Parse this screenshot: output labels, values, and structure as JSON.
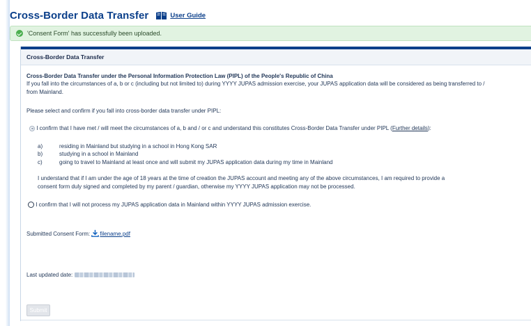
{
  "header": {
    "title": "Cross-Border Data Transfer",
    "user_guide_label": "User Guide",
    "user_guide_icon": "book-icon"
  },
  "alert": {
    "icon": "check-circle-icon",
    "message": "'Consent Form' has successfully been uploaded.",
    "color": "#4caf50"
  },
  "panel": {
    "heading": "Cross-Border Data Transfer",
    "accent_color": "#0b3f8a",
    "intro_title": "Cross-Border Data Transfer under the Personal Information Protection Law (PIPL) of the People's Republic of China",
    "intro_line1": "If you fall into the circumstances of a, b or c (including but not limited to) during YYYY JUPAS admission exercise, your JUPAS application data will be considered as being transferred to /",
    "intro_line2": "from Mainland.",
    "prompt": "Please select and confirm if you fall into cross-border data transfer under PIPL:",
    "option1_text": "I confirm that I have met / will meet the circumstances of a, b and / or c and understand this constitutes Cross-Border Data Transfer under PIPL (",
    "option1_link": "Further details",
    "option1_suffix": "):",
    "circumstances": [
      {
        "letter": "a)",
        "text": "residing in Mainland but studying in a school in Hong Kong SAR"
      },
      {
        "letter": "b)",
        "text": "studying in a school in Mainland"
      },
      {
        "letter": "c)",
        "text": "going to travel to Mainland at least once and will submit my JUPAS application data during my time in Mainland"
      }
    ],
    "understand_line1": "I understand that if I am under the age of 18 years at the time of creation the JUPAS account and meeting any of the above circumstances, I am required to provide a",
    "understand_line2": "consent form duly signed and completed by my parent / guardian, otherwise my YYYY JUPAS application may not be processed.",
    "option2_text": "I confirm that I will not process my JUPAS application data in Mainland within YYYY JUPAS admission exercise.",
    "submitted_label": "Submitted Consent Form:",
    "submitted_file": "filename.pdf",
    "download_icon": "download-icon",
    "last_updated_label": "Last updated date:",
    "submit_label": "Submit"
  }
}
